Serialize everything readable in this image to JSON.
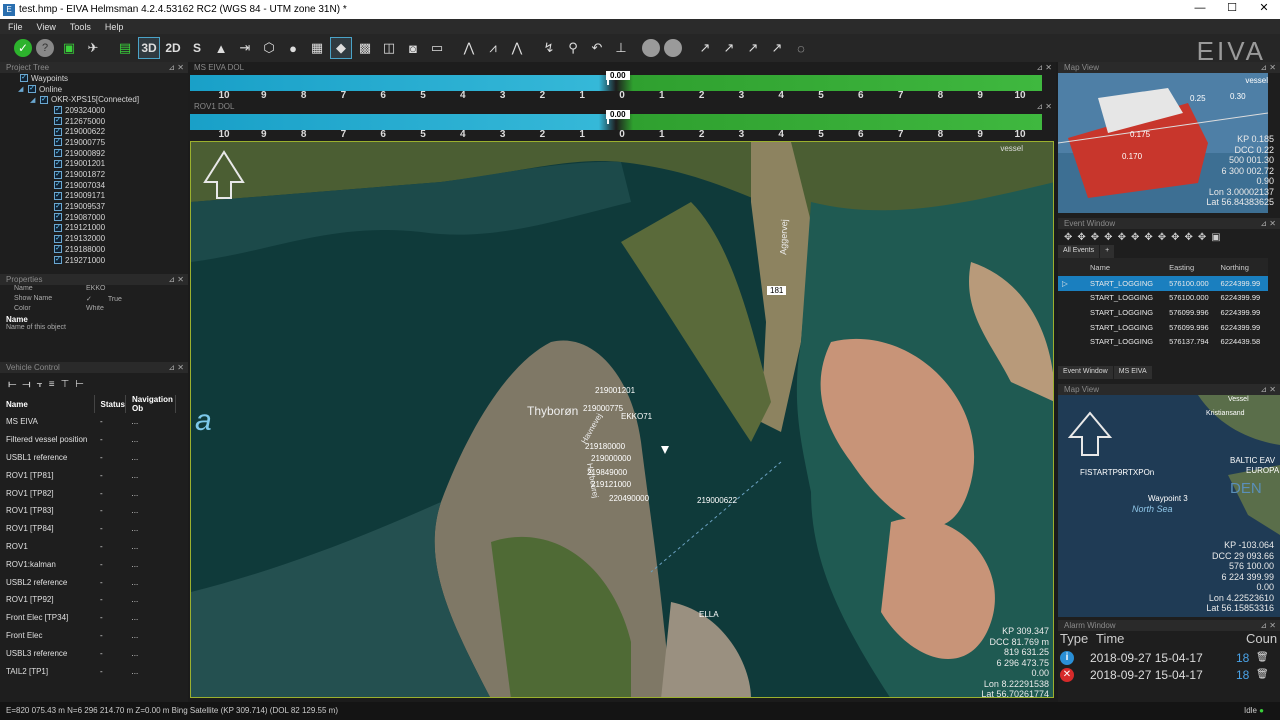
{
  "window": {
    "title": "test.hmp - EIVA Helmsman 4.2.4.53162 RC2 (WGS 84 - UTM zone 31N) *",
    "min": "—",
    "max": "☐",
    "close": "✕"
  },
  "menu": [
    "File",
    "View",
    "Tools",
    "Help"
  ],
  "toolbar": {
    "btn_3d": "3D",
    "btn_2d": "2D",
    "btn_s": "S",
    "brand": "EIVA"
  },
  "project_tree": {
    "title": "Project Tree",
    "waypoints": "Waypoints",
    "online": "Online",
    "connection": "OKR-XPS15[Connected]",
    "items": [
      "209324000",
      "212675000",
      "219000622",
      "219000775",
      "219000892",
      "219001201",
      "219001872",
      "219007034",
      "219009171",
      "219009537",
      "219087000",
      "219121000",
      "219132000",
      "219188000",
      "219271000"
    ]
  },
  "properties": {
    "title": "Properties",
    "rows": [
      {
        "k": "Name",
        "v": "EKKO"
      },
      {
        "k": "Show Name",
        "v": "True"
      },
      {
        "k": "Color",
        "v": "White"
      }
    ],
    "desc_title": "Name",
    "desc_text": "Name of this object"
  },
  "vehicle_control": {
    "title": "Vehicle Control",
    "headers": [
      "Name",
      "Status",
      "Navigation Ob"
    ],
    "rows": [
      "MS EIVA",
      "Filtered vessel position",
      "USBL1 reference",
      "ROV1 [TP81]",
      "ROV1 [TP82]",
      "ROV1 [TP83]",
      "ROV1 [TP84]",
      "ROV1",
      "ROV1:kalman",
      "USBL2 reference",
      "ROV1 [TP92]",
      "Front Elec [TP34]",
      "Front Elec",
      "USBL3 reference",
      "TAIL2 [TP1]"
    ],
    "status": "-",
    "nav": "..."
  },
  "dol1": {
    "title": "MS EIVA DOL",
    "value": "0.00"
  },
  "dol2": {
    "title": "ROV1 DOL",
    "value": "0.00"
  },
  "dol_ticks": [
    "10",
    "9",
    "8",
    "7",
    "6",
    "5",
    "4",
    "3",
    "2",
    "1",
    "0",
    "1",
    "2",
    "3",
    "4",
    "5",
    "6",
    "7",
    "8",
    "9",
    "10"
  ],
  "map": {
    "vessel_label": "vessel",
    "town": "Thyborøn",
    "road1": "Aggervej",
    "road2": "181",
    "road3": "Havnevej",
    "road4": "Harbourej",
    "partial_text": "a",
    "ella": "ELLA",
    "targets": [
      "219001201",
      "219000775",
      "EKKO71",
      "219180000",
      "219000000",
      "219849000",
      "219121000",
      "220490000",
      "219000622"
    ],
    "readout": {
      "kp": "KP 309.347",
      "dcc": "DCC 81.769 m",
      "e": "819 631.25",
      "n": "6 296 473.75",
      "z": "0.00",
      "lon": "Lon 8.22291538",
      "lat": "Lat 56.70261774"
    }
  },
  "mapview1": {
    "title": "Map View",
    "vessel_label": "vessel",
    "labels": [
      "0.175",
      "0.170",
      "0.25",
      "0.30"
    ],
    "readout": {
      "kp": "KP 0.185",
      "dcc": "DCC 0.22",
      "e": "500 001.30",
      "n": "6 300 002.72",
      "z": "0.90",
      "lon": "Lon 3.00002137",
      "lat": "Lat 56.84383625"
    }
  },
  "events": {
    "title": "Event Window",
    "tab_all": "All Events",
    "tab_add": "+",
    "headers": [
      "Name",
      "Easting",
      "Northing"
    ],
    "rows": [
      {
        "name": "START_LOGGING",
        "e": "576100.000",
        "n": "6224399.99"
      },
      {
        "name": "START_LOGGING",
        "e": "576100.000",
        "n": "6224399.99"
      },
      {
        "name": "START_LOGGING",
        "e": "576099.996",
        "n": "6224399.99"
      },
      {
        "name": "START_LOGGING",
        "e": "576099.996",
        "n": "6224399.99"
      },
      {
        "name": "START_LOGGING",
        "e": "576137.794",
        "n": "6224439.58"
      }
    ],
    "bottom_tabs": [
      "Event Window",
      "MS EIVA"
    ]
  },
  "mapview2": {
    "title": "Map View",
    "labels": [
      "Vessel",
      "Kristiansand",
      "FISTARTP9RTXPOn",
      "Waypoint 3",
      "North Sea",
      "BALTIC EAV",
      "EUROPA",
      "DEN"
    ],
    "readout": {
      "kp": "KP -103.064",
      "dcc": "DCC 29 093.66",
      "e": "576 100.00",
      "n": "6 224 399.99",
      "z": "0.00",
      "lon": "Lon 4.22523610",
      "lat": "Lat 56.15853316"
    }
  },
  "alarm": {
    "title": "Alarm Window",
    "headers": [
      "Type",
      "Time",
      "Coun"
    ],
    "rows": [
      {
        "icon": "i",
        "color": "#2a8fd6",
        "time": "2018-09-27 15-04-17",
        "count": "18"
      },
      {
        "icon": "✕",
        "color": "#d62a2a",
        "time": "2018-09-27 15-04-17",
        "count": "18"
      }
    ]
  },
  "status": {
    "text": "E=820 075.43 m N=6 296 214.70 m Z=0.00 m Bing Satellite (KP 309.714) (DOL 82 129.55 m)",
    "right": "Idle"
  }
}
